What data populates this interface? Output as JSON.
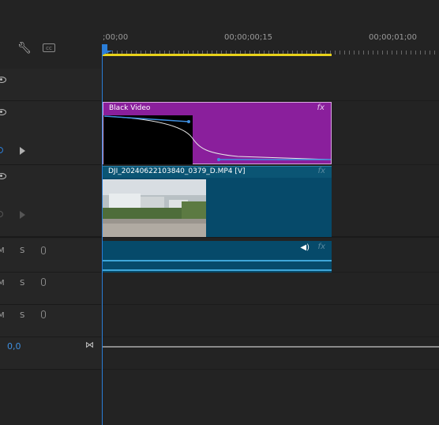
{
  "ruler": {
    "timecodes": [
      ";00;00",
      "00;00;00;15",
      "00;00;01;00"
    ]
  },
  "header_icons": [
    "wrench-icon",
    "captions-icon"
  ],
  "tracks": {
    "video": [
      {
        "id": "v3",
        "visible": true
      },
      {
        "id": "v2",
        "visible": true
      },
      {
        "id": "v1",
        "visible": true
      }
    ],
    "audio": [
      {
        "id": "a1",
        "mute": "M",
        "solo": "S"
      },
      {
        "id": "a2",
        "mute": "M",
        "solo": "S"
      },
      {
        "id": "a3",
        "mute": "M",
        "solo": "S"
      }
    ]
  },
  "clips": {
    "black_video": {
      "label": "Black Video",
      "fx": "fx",
      "color": "#8a1f9c"
    },
    "dji": {
      "label": "DJI_20240622103840_0379_D.MP4 [V]",
      "fx": "fx",
      "color": "#064a6a"
    },
    "audio": {
      "fx": "fx",
      "speaker": "◀)"
    }
  },
  "master": {
    "value": "0,0",
    "icon": "⋈"
  },
  "colors": {
    "playhead": "#2b7ed8",
    "workarea": "#e8d21a",
    "audio_wave": "#3fa6d8"
  }
}
